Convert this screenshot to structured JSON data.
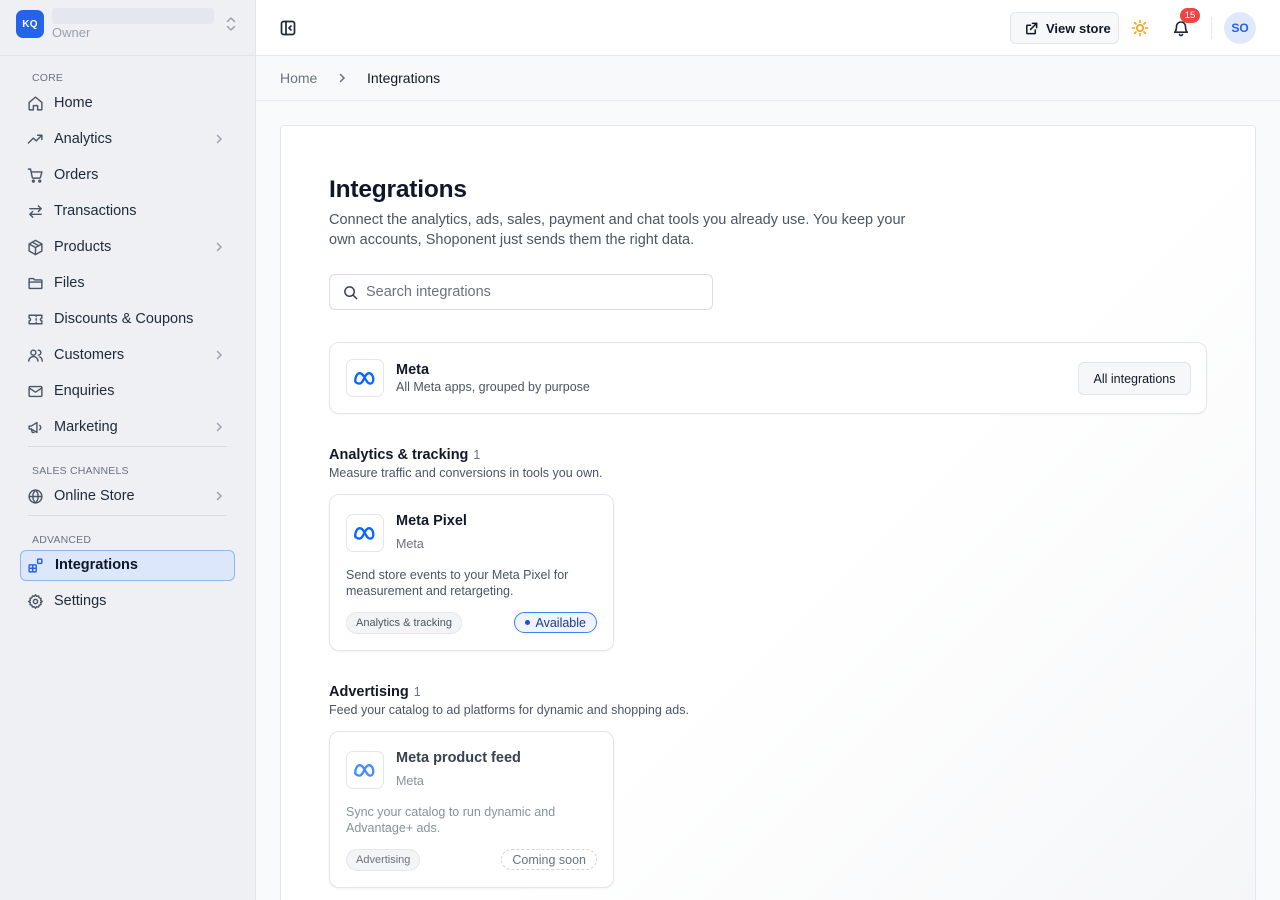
{
  "store": {
    "logo": "KQ",
    "role": "Owner"
  },
  "sidebar": {
    "sections": [
      {
        "label": "CORE"
      },
      {
        "label": "SALES CHANNELS"
      },
      {
        "label": "ADVANCED"
      }
    ],
    "items": [
      {
        "label": "Home",
        "icon": "home-icon"
      },
      {
        "label": "Analytics",
        "icon": "trend-icon"
      },
      {
        "label": "Orders",
        "icon": "cart-icon"
      },
      {
        "label": "Transactions",
        "icon": "arrows-icon"
      },
      {
        "label": "Products",
        "icon": "box-icon"
      },
      {
        "label": "Files",
        "icon": "folder-icon"
      },
      {
        "label": "Discounts & Coupons",
        "icon": "ticket-icon"
      },
      {
        "label": "Customers",
        "icon": "users-icon"
      },
      {
        "label": "Enquiries",
        "icon": "mail-icon"
      },
      {
        "label": "Marketing",
        "icon": "megaphone-icon"
      },
      {
        "label": "Online Store",
        "icon": "globe-icon"
      },
      {
        "label": "Integrations",
        "icon": "blocks-icon",
        "active": true
      },
      {
        "label": "Settings",
        "icon": "gear-icon"
      }
    ]
  },
  "topbar": {
    "view_store_label": "View store",
    "notification_count": "15",
    "avatar_initials": "SO"
  },
  "breadcrumb": {
    "home": "Home",
    "current": "Integrations"
  },
  "page": {
    "title": "Integrations",
    "description": "Connect the analytics, ads, sales, payment and chat tools you already use. You keep your own accounts, Shoponent just sends them the right data.",
    "search_placeholder": "Search integrations"
  },
  "meta_group": {
    "title": "Meta",
    "subtitle": "All Meta apps, grouped by purpose",
    "button_label": "All integrations"
  },
  "categories": [
    {
      "title": "Analytics & tracking",
      "count": "1",
      "description": "Measure traffic and conversions in tools you own.",
      "card": {
        "name": "Meta Pixel",
        "vendor": "Meta",
        "description": "Send store events to your Meta Pixel for measurement and retargeting.",
        "category": "Analytics & tracking",
        "status": "Available"
      }
    },
    {
      "title": "Advertising",
      "count": "1",
      "description": "Feed your catalog to ad platforms for dynamic and shopping ads.",
      "card": {
        "name": "Meta product feed",
        "vendor": "Meta",
        "description": "Sync your catalog to run dynamic and Advantage+ ads.",
        "category": "Advertising",
        "status": "Coming soon"
      }
    }
  ],
  "colors": {
    "accent": "#2563eb",
    "meta_blue": "#0866ff",
    "badge_red": "#ef4444",
    "theme_icon": "#f59e0b"
  }
}
